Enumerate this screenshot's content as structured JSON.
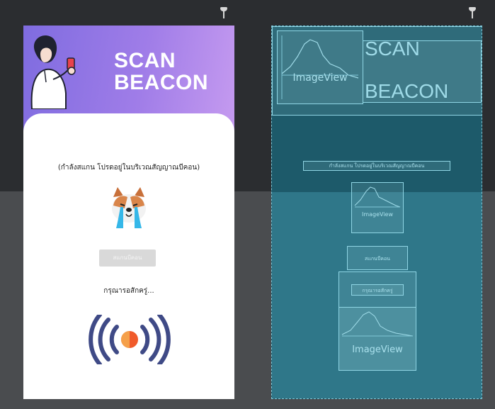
{
  "app_preview": {
    "title_line1": "SCAN",
    "title_line2": "BEACON",
    "status_text": "(กำลังสแกน โปรดอยู่ในบริเวณสัญญาณบีคอน)",
    "scan_button_label": "สแกนบีคอน",
    "waiting_text": "กรุณารอสักครู่..."
  },
  "blueprint": {
    "header_image_label": "ImageView",
    "title_line1": "SCAN",
    "title_line2": "BEACON",
    "status_text": "กำลังสแกน โปรดอยู่ในบริเวณสัญญาณบีคอน",
    "dog_image_label": "ImageView",
    "button_label": "สแกนบีคอน",
    "waiting_text": "กรุณารอสักครู่",
    "beacon_image_label": "ImageView"
  },
  "colors": {
    "canvas": "#2b2d30",
    "header_gradient_start": "#7f6ce0",
    "header_gradient_end": "#c79cf0",
    "blueprint_bg": "#1d5a6a",
    "blueprint_outline": "#8fd5e4",
    "beacon_arcs": "#3f4a86",
    "beacon_center": "#f05a2a"
  },
  "icons": {
    "pin_left": "pin-icon",
    "pin_right": "pin-icon",
    "header": "woman-with-phone-illustration",
    "dog": "crying-dog-icon",
    "beacon": "beacon-signal-icon"
  }
}
